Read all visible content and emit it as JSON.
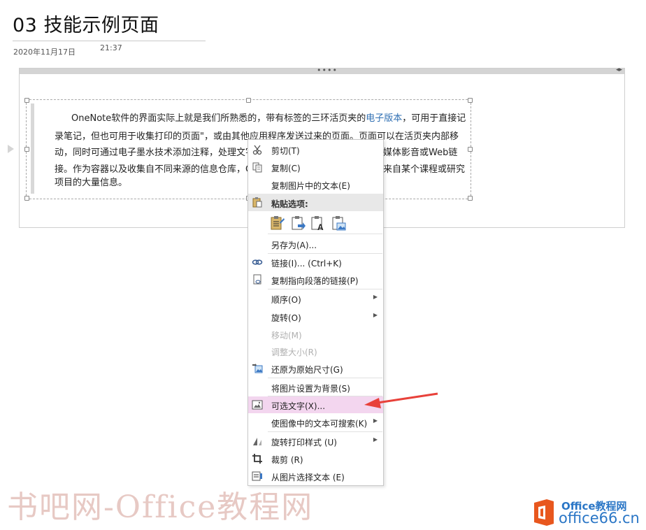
{
  "page": {
    "title": "03 技能示例页面",
    "date": "2020年11月17日",
    "time": "21:37"
  },
  "container": {
    "drag_handle": "••••",
    "resize": "◂▸"
  },
  "paragraph": {
    "before_link": "OneNote软件的界面实际上就是我们所熟悉的，带有标签的三环活页夹的",
    "link": "电子版本",
    "after_link": "，可用于直接记录笔记，但也可用于收集打印的页面\"，或由其他应用程序发送过来的页面。页面可以在活页夹内部移动，同时可通过电子墨水技术添加注释，处理文字",
    "hidden_tail": "媒体影音或Web链接。作为容器以及收集自不同来源的信息仓库，",
    "visible_tail": "来自某个课程或研究项目的大量信息。",
    "line3_right": "媒体影音或Web链",
    "line4_left": "接。作为容器以及收集自不同来源的信息仓库，C",
    "line4_right": "来自某个课程或研究",
    "line5": "项目的大量信息。"
  },
  "context_menu": {
    "items": [
      {
        "label": "剪切(T)",
        "icon": "scissors-icon"
      },
      {
        "label": "复制(C)",
        "icon": "copy-icon"
      },
      {
        "label": "复制图片中的文本(E)",
        "icon": ""
      },
      {
        "label": "粘贴选项:",
        "icon": "paste-icon"
      },
      {
        "label": "另存为(A)...",
        "icon": ""
      },
      {
        "label": "链接(I)...  (Ctrl+K)",
        "icon": "link-icon"
      },
      {
        "label": "复制指向段落的链接(P)",
        "icon": "paragraph-link-icon"
      },
      {
        "label": "顺序(O)",
        "icon": "",
        "submenu": true
      },
      {
        "label": "旋转(O)",
        "icon": "",
        "submenu": true
      },
      {
        "label": "移动(M)",
        "icon": "",
        "disabled": true
      },
      {
        "label": "调整大小(R)",
        "icon": "",
        "disabled": true
      },
      {
        "label": "还原为原始尺寸(G)",
        "icon": "restore-size-icon"
      },
      {
        "label": "将图片设置为背景(S)",
        "icon": ""
      },
      {
        "label": "可选文字(X)...",
        "icon": "alt-text-icon",
        "highlighted": true
      },
      {
        "label": "使图像中的文本可搜索(K)",
        "icon": "",
        "submenu": true
      },
      {
        "label": "旋转打印样式 (U)",
        "icon": "rotate-print-icon",
        "submenu": true
      },
      {
        "label": "裁剪 (R)",
        "icon": "crop-icon"
      },
      {
        "label": "从图片选择文本 (E)",
        "icon": "select-text-icon"
      }
    ],
    "submenu_glyph": "▶"
  },
  "watermark": "书吧网-Office教程网",
  "branding": {
    "name": "Office教程网",
    "url": "office66.cn"
  },
  "colors": {
    "highlight": "#f3d6ef",
    "arrow": "#e8413a",
    "link": "#2f6fb3",
    "office_orange": "#e8571e",
    "office_blue": "#2a76c6"
  }
}
